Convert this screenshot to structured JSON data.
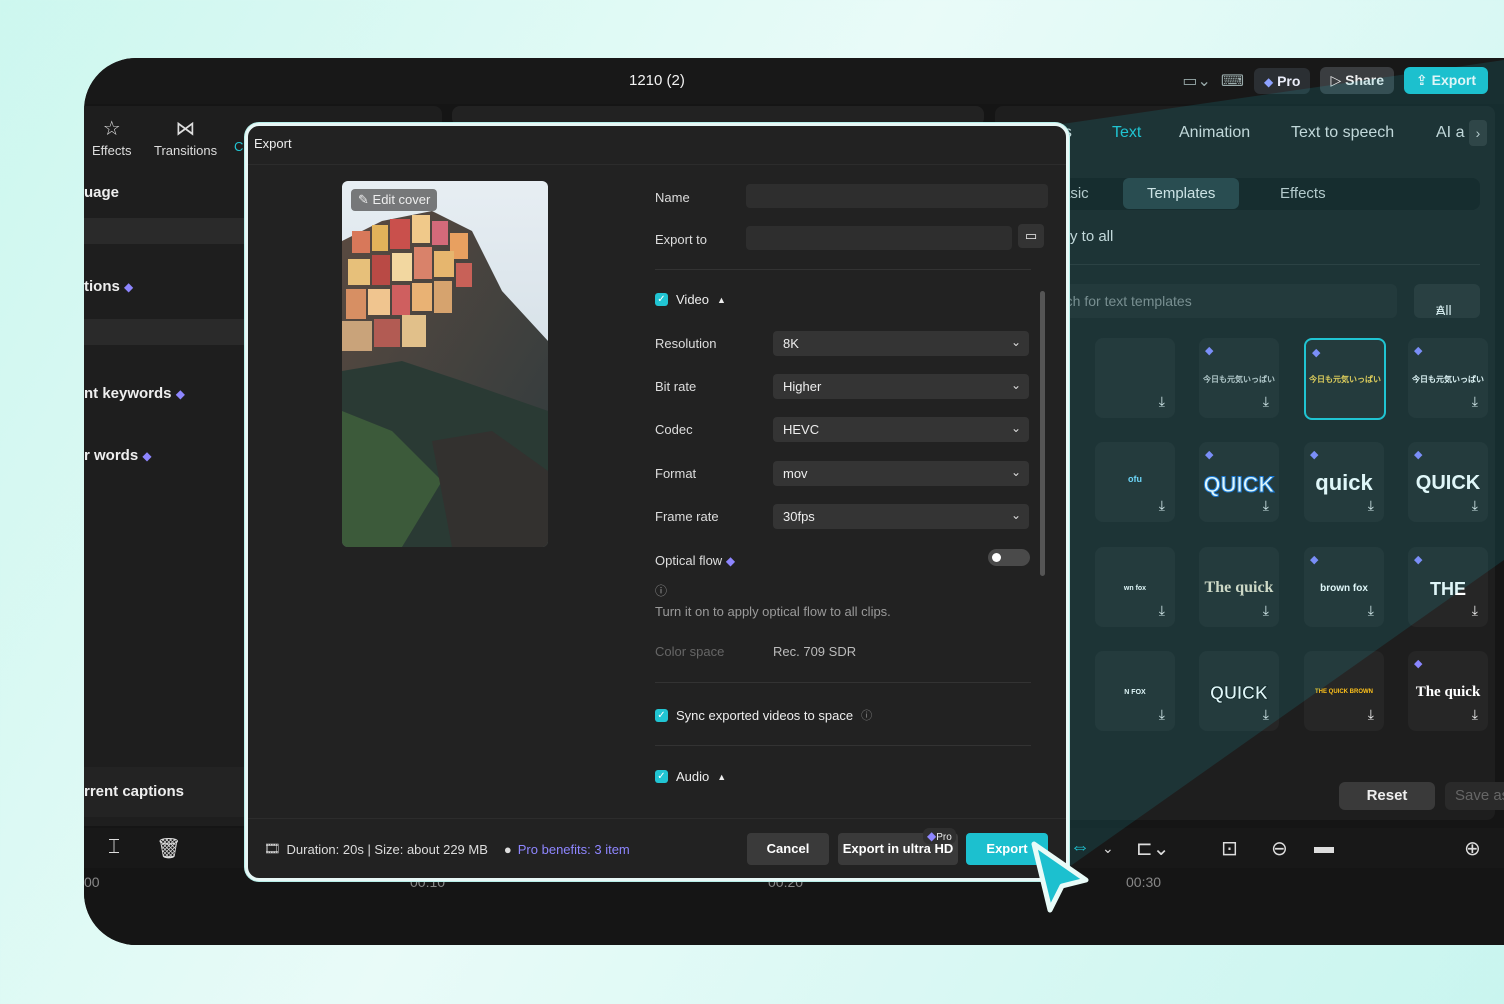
{
  "app": {
    "title": "1210 (2)"
  },
  "topbar": {
    "pro_label": "Pro",
    "share_label": "Share",
    "export_label": "Export"
  },
  "left_toolbar": {
    "effects_label": "Effects",
    "transitions_label": "Transitions",
    "partial_label": "C"
  },
  "left_panel": {
    "items": [
      "uage",
      "tions",
      "nt keywords",
      "r words"
    ],
    "captions_label": "rrent captions"
  },
  "right_panel": {
    "tabs": [
      {
        "label": "ns"
      },
      {
        "label": "Text"
      },
      {
        "label": "Animation"
      },
      {
        "label": "Text to speech"
      },
      {
        "label": "AI a"
      }
    ],
    "sub_tabs": [
      "asic",
      "Templates",
      "Effects"
    ],
    "apply_all": "y to all",
    "search_placeholder": "rch for text templates",
    "filter_label": "All",
    "templates": [
      [
        "",
        "今日も元気いっぱい",
        "今日も元気いっぱい",
        "今日も元気いっぱい"
      ],
      [
        "ofu",
        "QUICK",
        "quick",
        "QUICK"
      ],
      [
        "wn fox",
        "The quick",
        "brown fox",
        "THE"
      ],
      [
        "N FOX",
        "QUICK",
        "THE QUICK BROWN",
        "The quick"
      ]
    ],
    "reset_label": "Reset",
    "save_preset_label": "Save as preset"
  },
  "timeline": {
    "marks": [
      "00",
      "00:10",
      "00:20",
      "00:30"
    ]
  },
  "export_dialog": {
    "title": "Export",
    "edit_cover": "Edit cover",
    "name_label": "Name",
    "name_value": "",
    "export_to_label": "Export to",
    "export_to_value": "",
    "video_label": "Video",
    "resolution_label": "Resolution",
    "resolution_value": "8K",
    "bitrate_label": "Bit rate",
    "bitrate_value": "Higher",
    "codec_label": "Codec",
    "codec_value": "HEVC",
    "format_label": "Format",
    "format_value": "mov",
    "framerate_label": "Frame rate",
    "framerate_value": "30fps",
    "optical_flow_label": "Optical flow",
    "optical_flow_hint": "Turn it on to apply optical flow to all clips.",
    "color_space_label": "Color space",
    "color_space_value": "Rec. 709 SDR",
    "sync_label": "Sync exported videos to space",
    "audio_label": "Audio",
    "footer_info": "Duration: 20s | Size: about 229 MB",
    "pro_benefits": "Pro benefits: 3 item",
    "cancel_label": "Cancel",
    "ultra_label": "Export in ultra HD",
    "ultra_badge": "Pro",
    "export_label": "Export"
  },
  "colors": {
    "accent": "#1cc0cf",
    "pro": "#8e86ff",
    "background": "#151515"
  }
}
